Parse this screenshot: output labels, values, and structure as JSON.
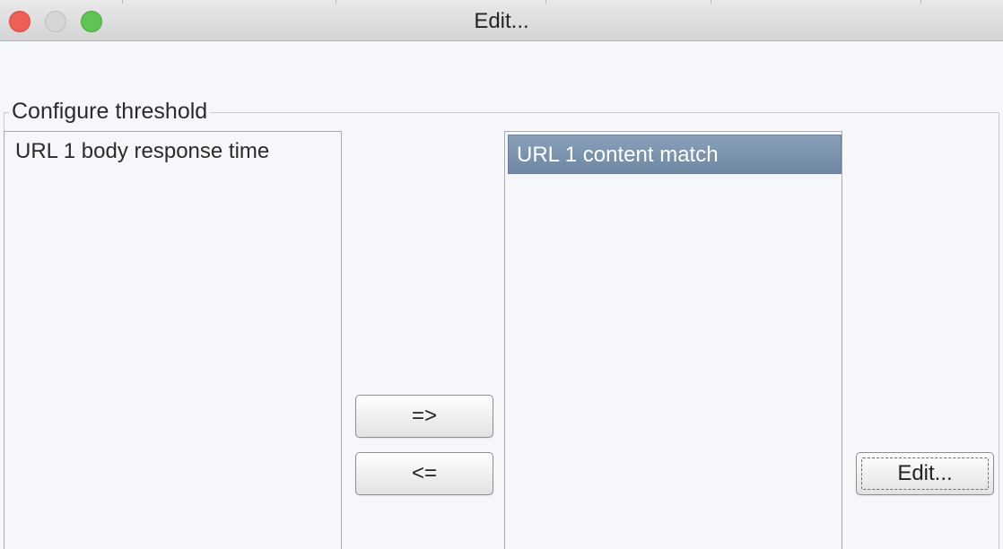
{
  "window": {
    "title": "Edit..."
  },
  "group": {
    "title": "Configure threshold"
  },
  "available_list": {
    "items": [
      "URL 1 body response time"
    ]
  },
  "selected_list": {
    "items": [
      "URL 1 content match"
    ],
    "selected_index": 0
  },
  "buttons": {
    "add_label": "=>",
    "remove_label": "<=",
    "edit_label": "Edit..."
  },
  "colors": {
    "selection": "#7b92ad",
    "close": "#ee5f57",
    "maximize": "#5fc453"
  }
}
